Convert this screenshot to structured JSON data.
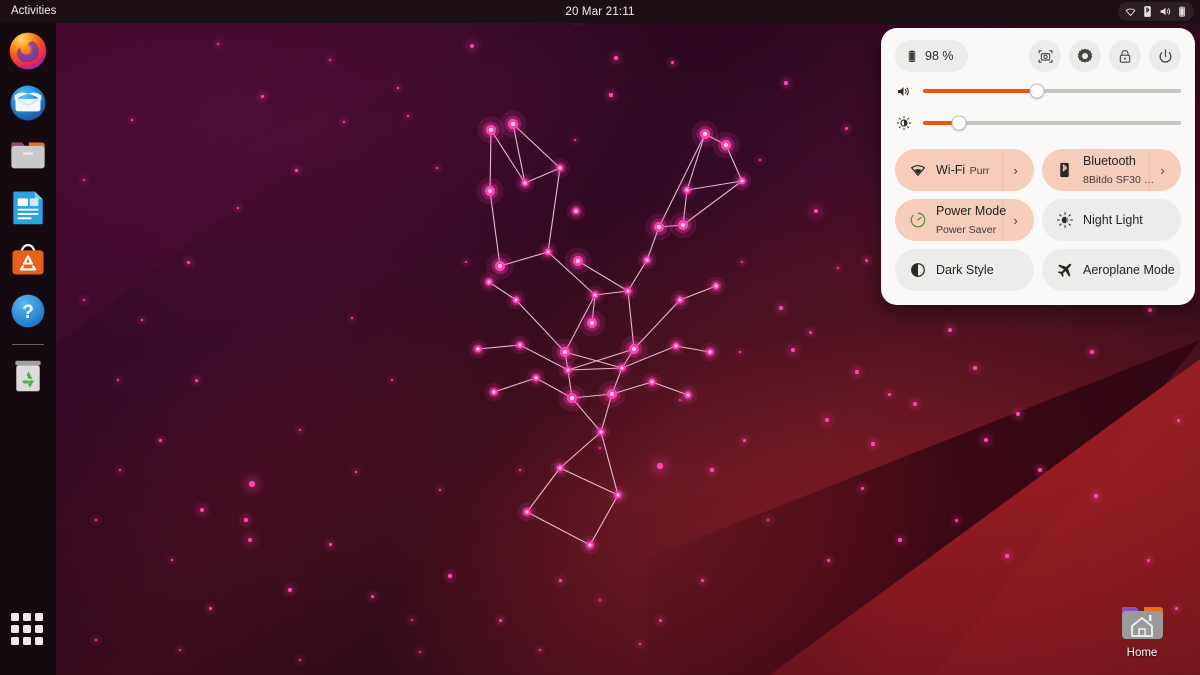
{
  "topbar": {
    "activities_label": "Activities",
    "clock": "20 Mar  21:11",
    "status_icons": [
      "wifi-icon",
      "bluetooth-icon",
      "volume-icon",
      "battery-icon"
    ]
  },
  "dock": {
    "items": [
      {
        "name": "firefox",
        "label": "Firefox"
      },
      {
        "name": "thunderbird",
        "label": "Thunderbird Mail"
      },
      {
        "name": "files",
        "label": "Files"
      },
      {
        "name": "libreoffice-writer",
        "label": "LibreOffice Writer"
      },
      {
        "name": "ubuntu-software",
        "label": "Ubuntu Software"
      },
      {
        "name": "help",
        "label": "Help"
      },
      {
        "name": "trash",
        "label": "Trash"
      }
    ],
    "app_grid_label": "Show Applications"
  },
  "desktop": {
    "icons": [
      {
        "name": "home-folder",
        "label": "Home"
      }
    ]
  },
  "quick_settings": {
    "battery": {
      "icon": "battery-icon",
      "label": "98 %"
    },
    "header_buttons": [
      {
        "name": "screenshot-button",
        "icon": "screenshot-icon"
      },
      {
        "name": "settings-button",
        "icon": "gear-icon"
      },
      {
        "name": "lock-button",
        "icon": "lock-icon"
      },
      {
        "name": "power-button",
        "icon": "power-icon"
      }
    ],
    "sliders": [
      {
        "name": "volume-slider",
        "icon": "volume-icon",
        "value": 44
      },
      {
        "name": "brightness-slider",
        "icon": "brightness-icon",
        "value": 14
      }
    ],
    "tiles": [
      {
        "name": "wifi-tile",
        "icon": "wifi-icon",
        "title": "Wi-Fi",
        "subtitle": "Purr",
        "active": true,
        "arrow": "›"
      },
      {
        "name": "bluetooth-tile",
        "icon": "bluetooth-icon",
        "title": "Bluetooth",
        "subtitle": "8Bitdo SF30 …",
        "active": true,
        "arrow": "›"
      },
      {
        "name": "power-mode-tile",
        "icon": "power-mode-icon",
        "title": "Power Mode",
        "subtitle": "Power Saver",
        "active": true,
        "arrow": "›"
      },
      {
        "name": "night-light-tile",
        "icon": "night-light-icon",
        "title": "Night Light",
        "subtitle": "",
        "active": false,
        "arrow": ""
      },
      {
        "name": "dark-style-tile",
        "icon": "dark-style-icon",
        "title": "Dark Style",
        "subtitle": "",
        "active": false,
        "arrow": ""
      },
      {
        "name": "aeroplane-mode-tile",
        "icon": "aeroplane-icon",
        "title": "Aeroplane Mode",
        "subtitle": "",
        "active": false,
        "arrow": ""
      }
    ]
  },
  "colors": {
    "accent_orange": "#e8590c",
    "panel_bg": "#faf9f8",
    "tile_inactive": "#ececea",
    "tile_active": "#f6cdbb",
    "topbar_bg": "#1c1016",
    "dock_bg": "#140a10"
  }
}
